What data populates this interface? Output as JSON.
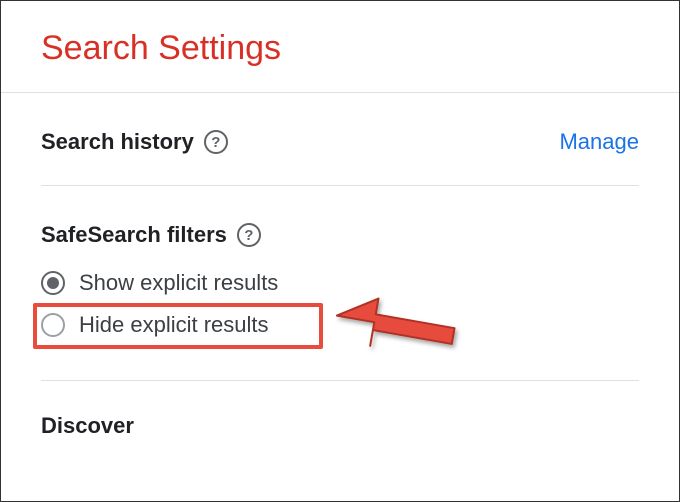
{
  "header": {
    "title": "Search Settings"
  },
  "sections": {
    "search_history": {
      "label": "Search history",
      "help_glyph": "?",
      "manage_link": "Manage"
    },
    "safesearch": {
      "label": "SafeSearch filters",
      "help_glyph": "?",
      "options": {
        "show": "Show explicit results",
        "hide": "Hide explicit results"
      }
    },
    "discover": {
      "label": "Discover"
    }
  },
  "annotation": {
    "highlight_color": "#e74c3c"
  }
}
